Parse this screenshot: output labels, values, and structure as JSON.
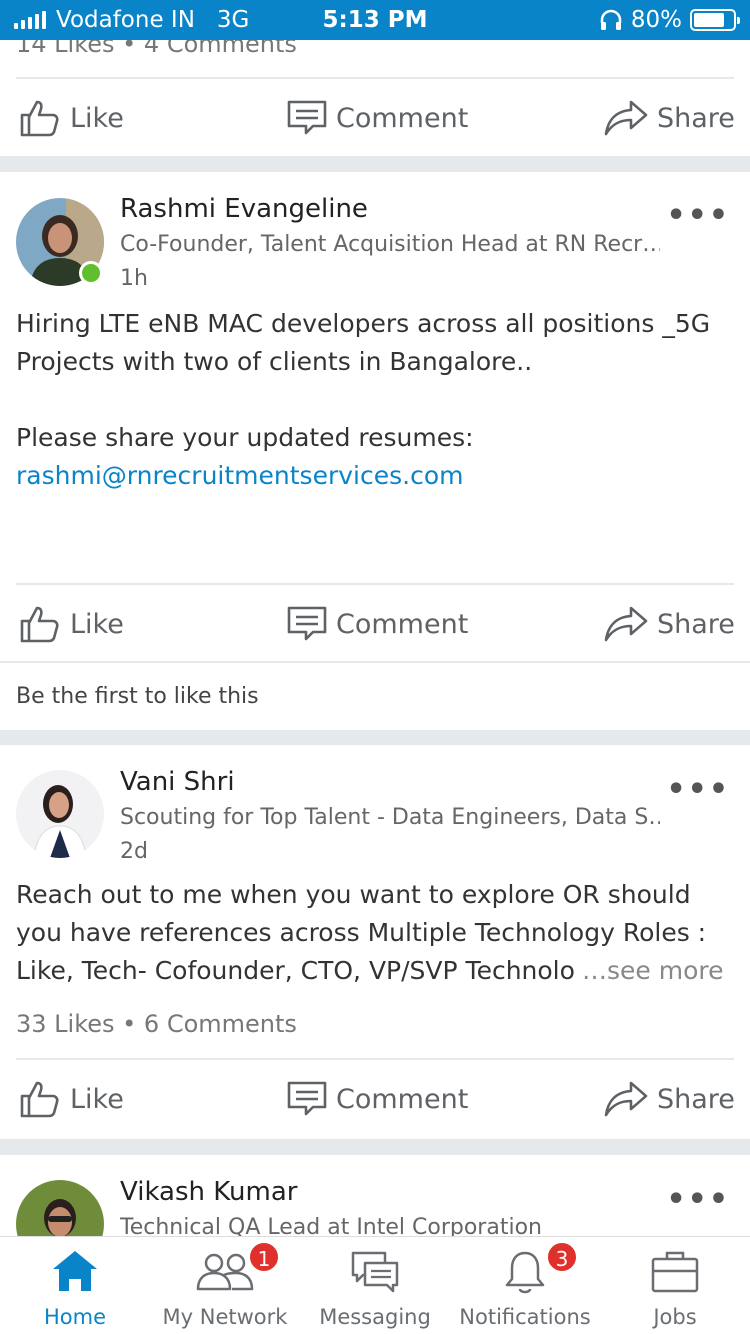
{
  "status_bar": {
    "carrier": "Vodafone IN",
    "network": "3G",
    "time": "5:13 PM",
    "battery": "80%",
    "battery_level": 0.8
  },
  "action_labels": {
    "like": "Like",
    "comment": "Comment",
    "share": "Share"
  },
  "top_post": {
    "stats": "14 Likes • 4 Comments"
  },
  "post1": {
    "author": "Rashmi Evangeline",
    "headline": "Co-Founder, Talent Acquisition Head at RN Recr…",
    "time": "1h",
    "line1": "Hiring LTE eNB MAC developers across all positions _5G",
    "line2": "Projects with two of clients in Bangalore..",
    "line3": "Please share your updated resumes:",
    "email": "rashmi@rnrecruitmentservices.com",
    "footer": "Be the first to like this"
  },
  "post2": {
    "author": "Vani Shri",
    "headline": "Scouting for Top Talent - Data Engineers, Data S…",
    "time": "2d",
    "line1": "Reach out to me when you want to explore OR should",
    "line2": "you have references  across Multiple Technology Roles :",
    "line3": "Like, Tech- Cofounder, CTO, VP/SVP Technolo",
    "see_more": "…see more",
    "stats": "33 Likes • 6 Comments"
  },
  "post3": {
    "author": "Vikash Kumar",
    "headline": "Technical QA Lead at Intel Corporation"
  },
  "bottom_nav": {
    "home": "Home",
    "network": "My Network",
    "network_badge": "1",
    "messaging": "Messaging",
    "notifications": "Notifications",
    "notifications_badge": "3",
    "jobs": "Jobs"
  },
  "colors": {
    "accent": "#0a84c9",
    "badge": "#e0302b",
    "online": "#5fbf2c"
  }
}
